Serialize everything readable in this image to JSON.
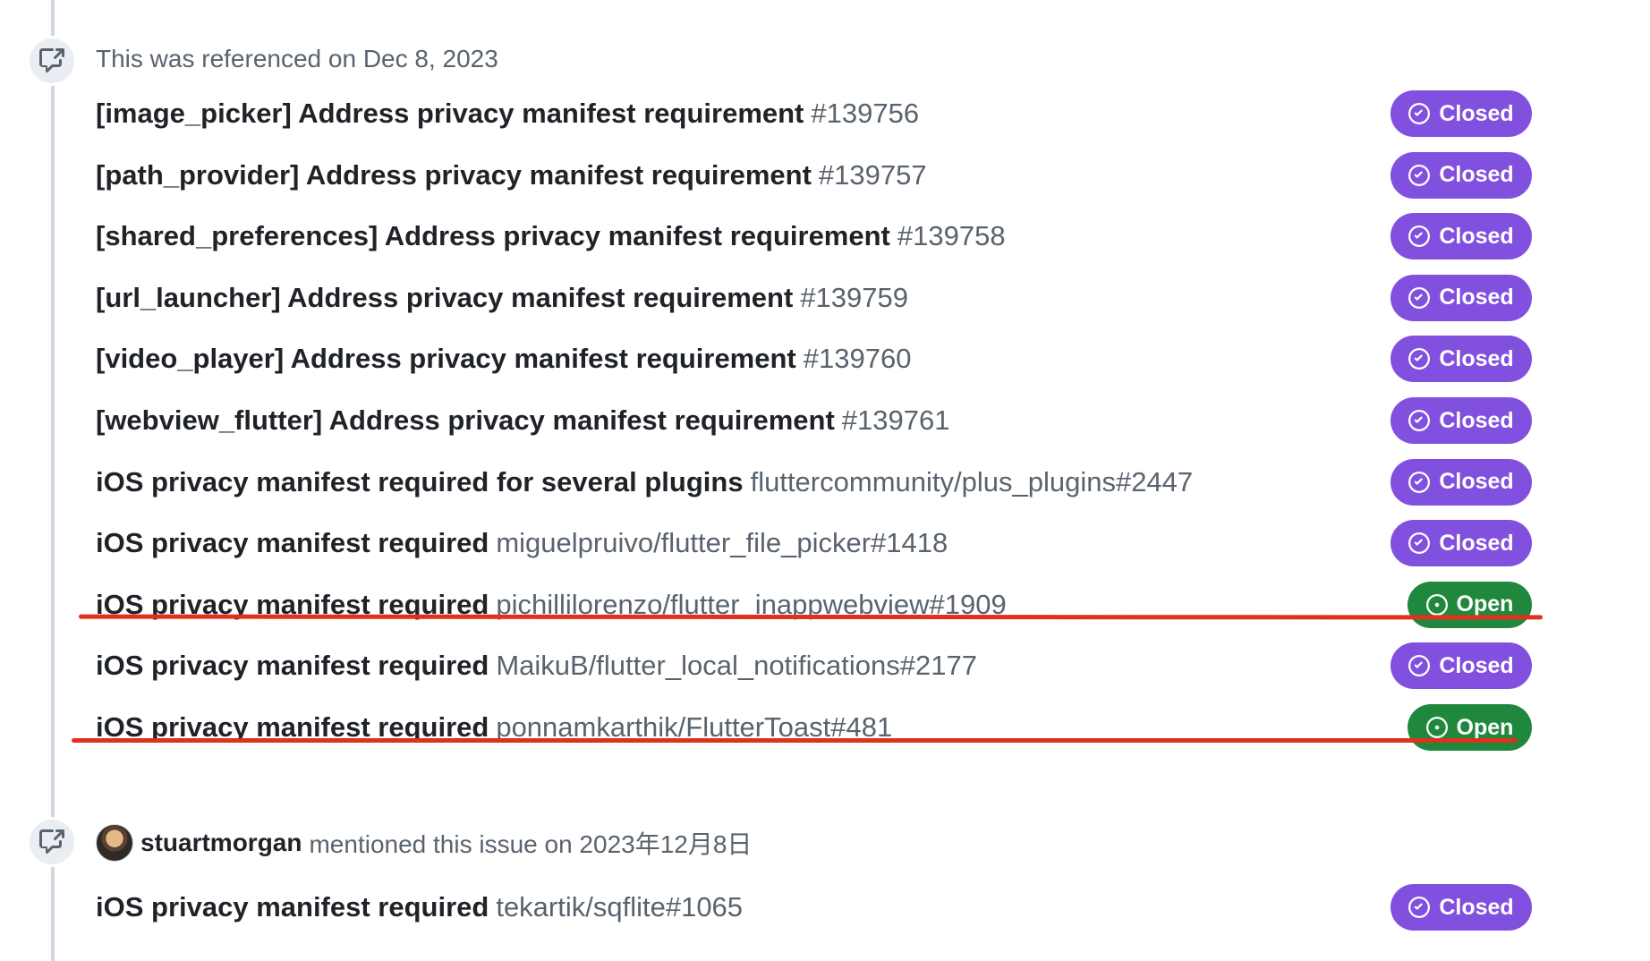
{
  "event1": {
    "header_text": "This was referenced on Dec 8, 2023",
    "references": [
      {
        "title": "[image_picker] Address privacy manifest requirement",
        "ref": "#139756",
        "status": "Closed"
      },
      {
        "title": "[path_provider] Address privacy manifest requirement",
        "ref": "#139757",
        "status": "Closed"
      },
      {
        "title": "[shared_preferences] Address privacy manifest requirement",
        "ref": "#139758",
        "status": "Closed"
      },
      {
        "title": "[url_launcher] Address privacy manifest requirement",
        "ref": "#139759",
        "status": "Closed"
      },
      {
        "title": "[video_player] Address privacy manifest requirement",
        "ref": "#139760",
        "status": "Closed"
      },
      {
        "title": "[webview_flutter] Address privacy manifest requirement",
        "ref": "#139761",
        "status": "Closed"
      },
      {
        "title": "iOS privacy manifest required for several plugins",
        "ref": "fluttercommunity/plus_plugins#2447",
        "status": "Closed"
      },
      {
        "title": "iOS privacy manifest required",
        "ref": "miguelpruivo/flutter_file_picker#1418",
        "status": "Closed"
      },
      {
        "title": "iOS privacy manifest required",
        "ref": "pichillilorenzo/flutter_inappwebview#1909",
        "status": "Open"
      },
      {
        "title": "iOS privacy manifest required",
        "ref": "MaikuB/flutter_local_notifications#2177",
        "status": "Closed"
      },
      {
        "title": "iOS privacy manifest required",
        "ref": "ponnamkarthik/FlutterToast#481",
        "status": "Open"
      }
    ]
  },
  "event2": {
    "author": "stuartmorgan",
    "action_text": "mentioned this issue on 2023年12月8日",
    "references": [
      {
        "title": "iOS privacy manifest required",
        "ref": "tekartik/sqflite#1065",
        "status": "Closed"
      }
    ]
  },
  "colors": {
    "closed_badge": "#8250df",
    "open_badge": "#1f883d",
    "annotation_underline": "#e0301e"
  },
  "icons": {
    "event_icon": "cross-reference-icon",
    "closed_icon": "check-circle-icon",
    "open_icon": "issue-opened-icon"
  }
}
